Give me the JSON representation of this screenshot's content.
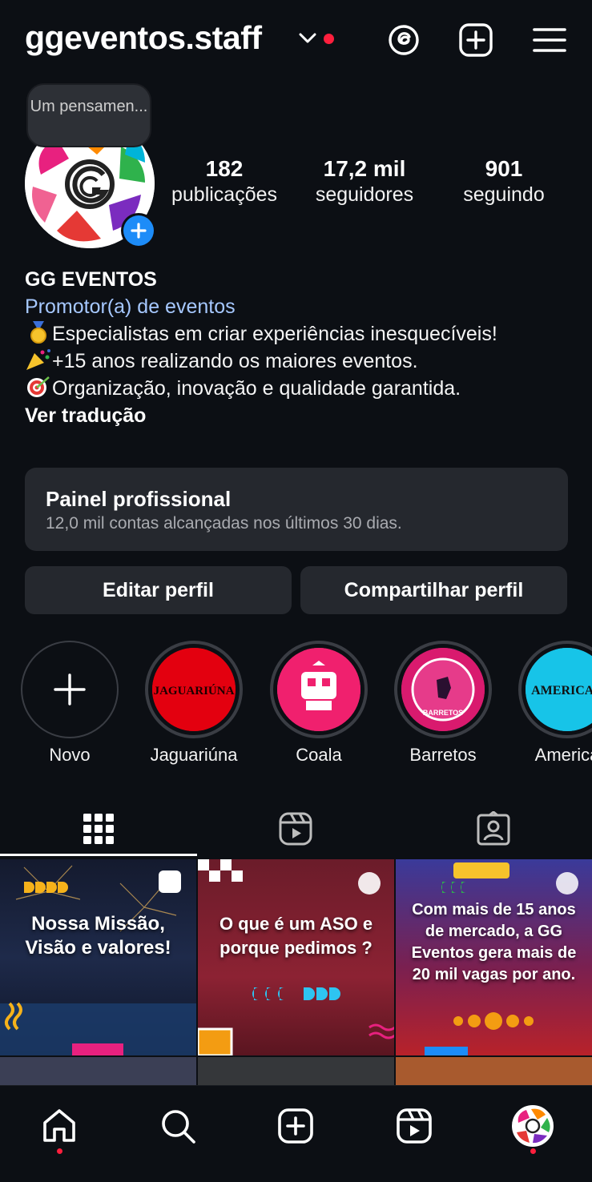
{
  "header": {
    "username": "ggeventos.staff",
    "icons": [
      "chevron-down-icon",
      "threads-icon",
      "create-icon",
      "menu-icon"
    ]
  },
  "profile": {
    "note": "Um pensamen...",
    "stats": [
      {
        "num": "182",
        "label": "publicações"
      },
      {
        "num": "17,2 mil",
        "label": "seguidores"
      },
      {
        "num": "901",
        "label": "seguindo"
      }
    ],
    "name": "GG EVENTOS",
    "category": "Promotor(a) de eventos",
    "bio_lines": [
      "Especialistas em criar experiências inesquecíveis!",
      "+15 anos realizando os maiores eventos.",
      "Organização, inovação e qualidade garantida."
    ],
    "translate": "Ver tradução"
  },
  "pro_panel": {
    "title": "Painel profissional",
    "subtitle": "12,0 mil contas alcançadas nos últimos 30 dias."
  },
  "buttons": {
    "edit": "Editar perfil",
    "share": "Compartilhar perfil"
  },
  "highlights": [
    {
      "label": "Novo",
      "art": ""
    },
    {
      "label": "Jaguariúna",
      "art": "JAGUARIÚNA"
    },
    {
      "label": "Coala",
      "art": ""
    },
    {
      "label": "Barretos",
      "art": "BARRETOS"
    },
    {
      "label": "America",
      "art": "AMERICAN"
    }
  ],
  "tabs": [
    "grid-icon",
    "reels-icon",
    "tagged-icon"
  ],
  "grid_posts": [
    {
      "caption": "Nossa Missão, Visão e valores!"
    },
    {
      "caption": "O que é um ASO e porque pedimos ?"
    },
    {
      "caption": "Com mais de 15 anos de mercado, a GG Eventos gera mais de 20 mil vagas por ano."
    }
  ],
  "nav": [
    "home-icon",
    "search-icon",
    "create-icon",
    "reels-icon",
    "profile-avatar"
  ],
  "colors": {
    "background": "#0c0f14",
    "card": "#25282e",
    "link": "#a6c8ff",
    "accent_blue": "#1d8cf8",
    "notification": "#ff1f3d"
  }
}
